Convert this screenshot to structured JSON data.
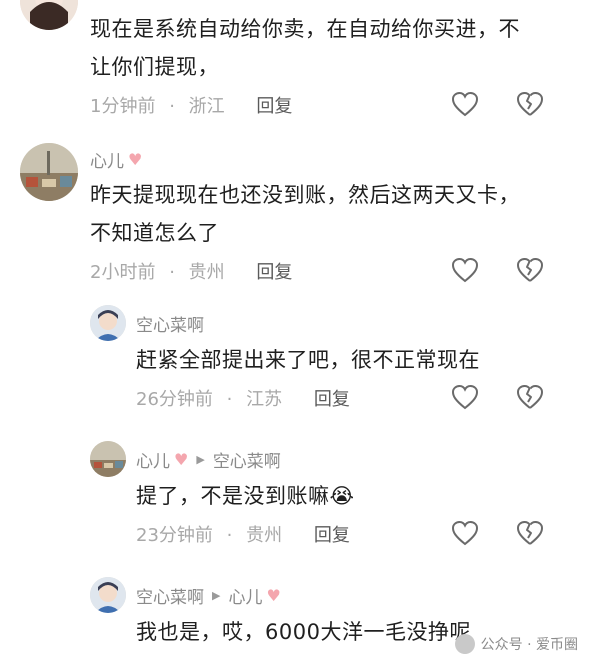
{
  "comments": [
    {
      "text": "现在是系统自动给你卖，在自动给你买进，不让你们提现，",
      "time": "1分钟前",
      "location": "浙江",
      "reply": "回复"
    },
    {
      "author": "心儿",
      "text": "昨天提现现在也还没到账，然后这两天又卡，不知道怎么了",
      "time": "2小时前",
      "location": "贵州",
      "reply": "回复"
    },
    {
      "author": "空心菜啊",
      "text": "赶紧全部提出来了吧，很不正常现在",
      "time": "26分钟前",
      "location": "江苏",
      "reply": "回复"
    },
    {
      "author": "心儿",
      "reply_to": "空心菜啊",
      "text": "提了，不是没到账嘛",
      "time": "23分钟前",
      "location": "贵州",
      "reply": "回复"
    },
    {
      "author": "空心菜啊",
      "reply_to": "心儿",
      "text": "我也是，哎，6000大洋一毛没挣呢"
    }
  ],
  "separator": "·",
  "watermark": "公众号 · 爱币圈",
  "icons": {
    "like": "heart-outline-icon",
    "dislike": "broken-heart-icon",
    "name_heart": "pink-heart-emoji",
    "crying": "crying-emoji"
  }
}
